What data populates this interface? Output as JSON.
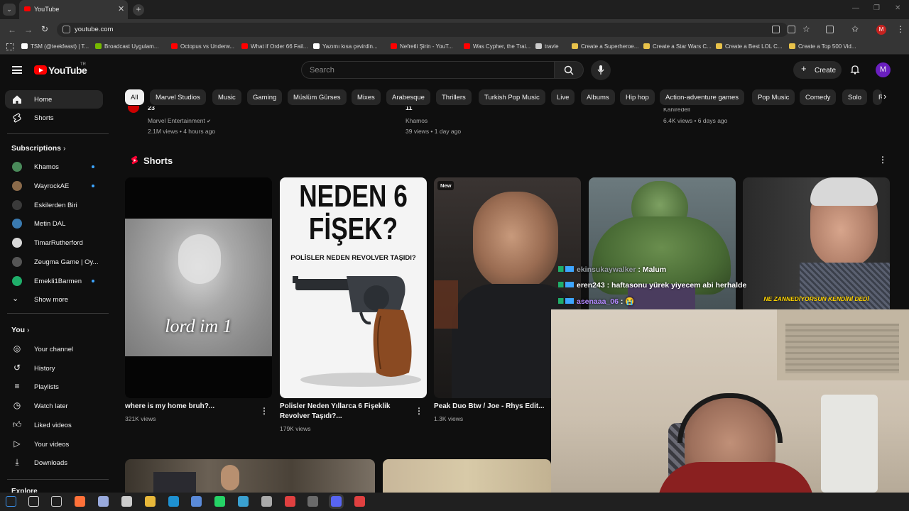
{
  "browser": {
    "tab_title": "YouTube",
    "url": "youtube.com",
    "profile_initial": "M",
    "bookmarks": [
      {
        "label": "TSM (@teekfeast) | T...",
        "color": "#ffffff"
      },
      {
        "label": "Broadcast Uygulam...",
        "color": "#76b900"
      },
      {
        "label": "Octopus vs Underw...",
        "color": "#ff0000"
      },
      {
        "label": "What if Order 66 Fail...",
        "color": "#ff0000"
      },
      {
        "label": "Yazımı kısa çevirdin...",
        "color": "#ffffff"
      },
      {
        "label": "Nefretli Şirin - YouT...",
        "color": "#ff0000"
      },
      {
        "label": "Was Cypher, the Trai...",
        "color": "#ff0000"
      },
      {
        "label": "travle",
        "color": "#cccccc"
      },
      {
        "label": "Create a Superheroe...",
        "color": "#e8c24a"
      },
      {
        "label": "Create a Star Wars C...",
        "color": "#e8c24a"
      },
      {
        "label": "Create a Best LOL C...",
        "color": "#e8c24a"
      },
      {
        "label": "Create a Top 500 Vid...",
        "color": "#e8c24a"
      }
    ]
  },
  "header": {
    "logo_text": "YouTube",
    "logo_sup": "TR",
    "search_placeholder": "Search",
    "create_label": "Create",
    "avatar_initial": "M"
  },
  "sidebar": {
    "main": [
      {
        "label": "Home",
        "icon": "home-icon"
      },
      {
        "label": "Shorts",
        "icon": "shorts-icon"
      }
    ],
    "subscriptions_title": "Subscriptions",
    "subscriptions": [
      {
        "label": "Khamos",
        "color": "#4a8a5a",
        "live_dot": true
      },
      {
        "label": "WayrockAE",
        "color": "#8a6a4a",
        "live_dot": true
      },
      {
        "label": "Eskilerden Biri",
        "color": "#3a3a3a",
        "live_dot": false
      },
      {
        "label": "Metin DAL",
        "color": "#3a7ab0",
        "live_dot": false
      },
      {
        "label": "TimarRutherford",
        "color": "#d8d8d8",
        "live_dot": false
      },
      {
        "label": "Zeugma Game | Oy...",
        "color": "#555555",
        "live_dot": false
      },
      {
        "label": "Emekli1Barmen",
        "color": "#1fae6a",
        "live_dot": true
      }
    ],
    "show_more": "Show more",
    "you_title": "You",
    "you_items": [
      {
        "label": "Your channel",
        "icon": "person-icon"
      },
      {
        "label": "History",
        "icon": "history-icon"
      },
      {
        "label": "Playlists",
        "icon": "playlists-icon"
      },
      {
        "label": "Watch later",
        "icon": "clock-icon"
      },
      {
        "label": "Liked videos",
        "icon": "thumbs-up-icon"
      },
      {
        "label": "Your videos",
        "icon": "video-icon"
      },
      {
        "label": "Downloads",
        "icon": "download-icon"
      }
    ],
    "explore_title": "Explore"
  },
  "chips": [
    "All",
    "Marvel Studios",
    "Music",
    "Gaming",
    "Müslüm Gürses",
    "Mixes",
    "Arabesque",
    "Thrillers",
    "Turkish Pop Music",
    "Live",
    "Albums",
    "Hip hop",
    "Action-adventure games",
    "Pop Music",
    "Comedy",
    "Solo",
    "R"
  ],
  "prev_row": [
    {
      "title": "23",
      "channel": "Marvel Entertainment",
      "verified": true,
      "stats": "2.1M views • 4 hours ago"
    },
    {
      "title": "11",
      "channel": "Khamos",
      "verified": false,
      "stats": "39 views • 1 day ago"
    },
    {
      "title": "",
      "channel": "Kaniredell",
      "verified": false,
      "stats": "6.4K views • 6 days ago"
    }
  ],
  "shorts_section": {
    "title": "Shorts",
    "items": [
      {
        "title": "where is my home bruh?...",
        "views": "321K views",
        "overlay": "lord im 1",
        "badge": ""
      },
      {
        "title": "Polisler Neden Yıllarca 6 Fişeklik Revolver Taşıdı?...",
        "views": "179K views",
        "overlay": "NEDEN 6 FİŞEK?",
        "overlay_sub": "POLİSLER NEDEN REVOLVER TAŞIDI?",
        "badge": ""
      },
      {
        "title": "Peak Duo Btw / Joe - Rhys Edit...",
        "views": "1.3K views",
        "overlay": "",
        "badge": "New"
      },
      {
        "title": "",
        "views": "",
        "overlay": "",
        "badge": ""
      },
      {
        "title": "",
        "views": "",
        "overlay": "NE ZANNEDİYORSUN KENDİNİ DEDİ",
        "badge": ""
      }
    ]
  },
  "chat_overlay": [
    {
      "user": "ekinsukaywalker",
      "message": "Malum",
      "color": "#9aa0a6"
    },
    {
      "user": "eren243",
      "message": "haftasonu yürek yiyecem abi herhalde",
      "color": "#ffffff"
    },
    {
      "user": "asenaaa_06",
      "message": "😭",
      "color": "#b388ff"
    }
  ],
  "taskbar_icons": [
    "windows-icon",
    "search-icon",
    "task-view-icon",
    "firefox-icon",
    "steam-icon",
    "store-icon",
    "folder-icon",
    "edge-icon",
    "app-icon",
    "whatsapp-icon",
    "app-icon-2",
    "app-icon-3",
    "chrome-icon",
    "obs-icon",
    "discord-icon",
    "chrome-icon-2"
  ]
}
